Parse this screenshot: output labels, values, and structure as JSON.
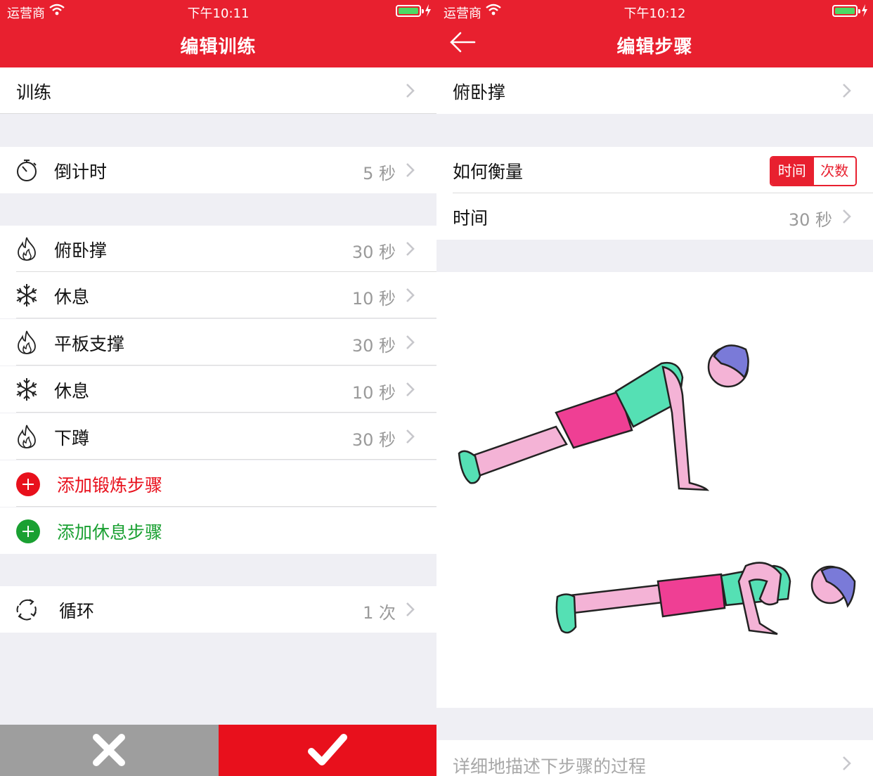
{
  "left_screen": {
    "status_bar": {
      "carrier": "运营商",
      "time": "下午10:11"
    },
    "nav_title": "编辑训练",
    "workout_row": {
      "label": "训练"
    },
    "countdown_row": {
      "label": "倒计时",
      "value": "5 秒",
      "icon": "stopwatch-icon"
    },
    "steps": [
      {
        "label": "俯卧撑",
        "value": "30 秒",
        "icon": "flame-icon"
      },
      {
        "label": "休息",
        "value": "10 秒",
        "icon": "snowflake-icon"
      },
      {
        "label": "平板支撑",
        "value": "30 秒",
        "icon": "flame-icon"
      },
      {
        "label": "休息",
        "value": "10 秒",
        "icon": "snowflake-icon"
      },
      {
        "label": "下蹲",
        "value": "30 秒",
        "icon": "flame-icon"
      }
    ],
    "add_exercise": {
      "label": "添加锻炼步骤",
      "color": "#e8101c"
    },
    "add_rest": {
      "label": "添加休息步骤",
      "color": "#1aa032"
    },
    "loop_row": {
      "label": "循环",
      "value": "1 次",
      "icon": "repeat-icon"
    },
    "cancel_icon": "close-icon",
    "confirm_icon": "checkmark-icon"
  },
  "right_screen": {
    "status_bar": {
      "carrier": "运营商",
      "time": "下午10:12"
    },
    "nav_title": "编辑步骤",
    "exercise_row": {
      "label": "俯卧撑"
    },
    "measure_row": {
      "label": "如何衡量",
      "options": [
        "时间",
        "次数"
      ],
      "selected": "时间"
    },
    "time_row": {
      "label": "时间",
      "value": "30 秒"
    },
    "description_placeholder": "详细地描述下步骤的过程"
  },
  "colors": {
    "accent": "#e8202f",
    "confirm": "#e8101c",
    "cancel": "#9e9e9e",
    "green": "#1aa032"
  }
}
